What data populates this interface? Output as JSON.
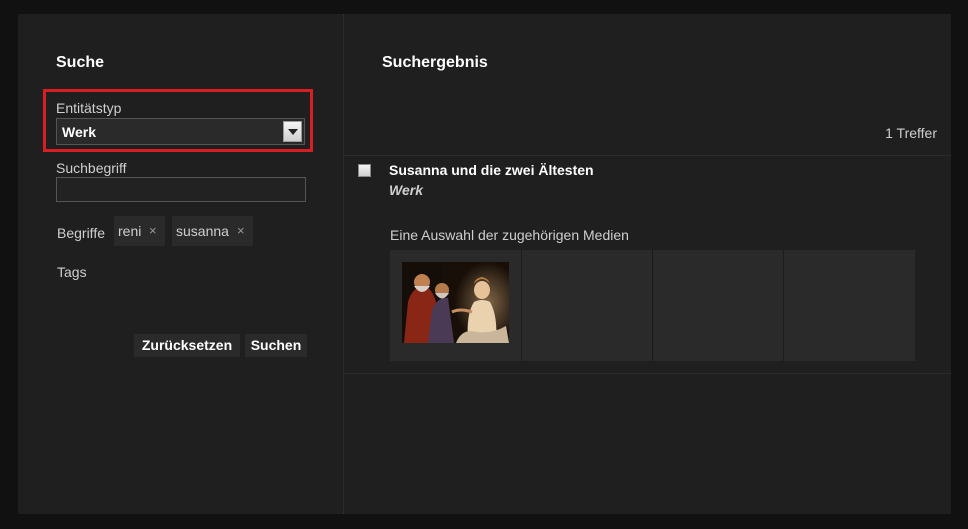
{
  "search": {
    "title": "Suche",
    "entity_type_label": "Entitätstyp",
    "entity_type_value": "Werk",
    "term_label": "Suchbegriff",
    "term_value": "",
    "terms_label": "Begriffe",
    "terms": [
      {
        "label": "reni",
        "remove": "×"
      },
      {
        "label": "susanna",
        "remove": "×"
      }
    ],
    "tags_label": "Tags",
    "reset_button": "Zurücksetzen",
    "search_button": "Suchen"
  },
  "results": {
    "title": "Suchergebnis",
    "count": "1 Treffer",
    "items": [
      {
        "title": "Susanna und die zwei Ältesten",
        "type": "Werk",
        "media_label": "Eine Auswahl der zugehörigen Medien"
      }
    ]
  },
  "colors": {
    "highlight": "#d81e25",
    "panel": "#1f1f1f",
    "background": "#111111"
  }
}
